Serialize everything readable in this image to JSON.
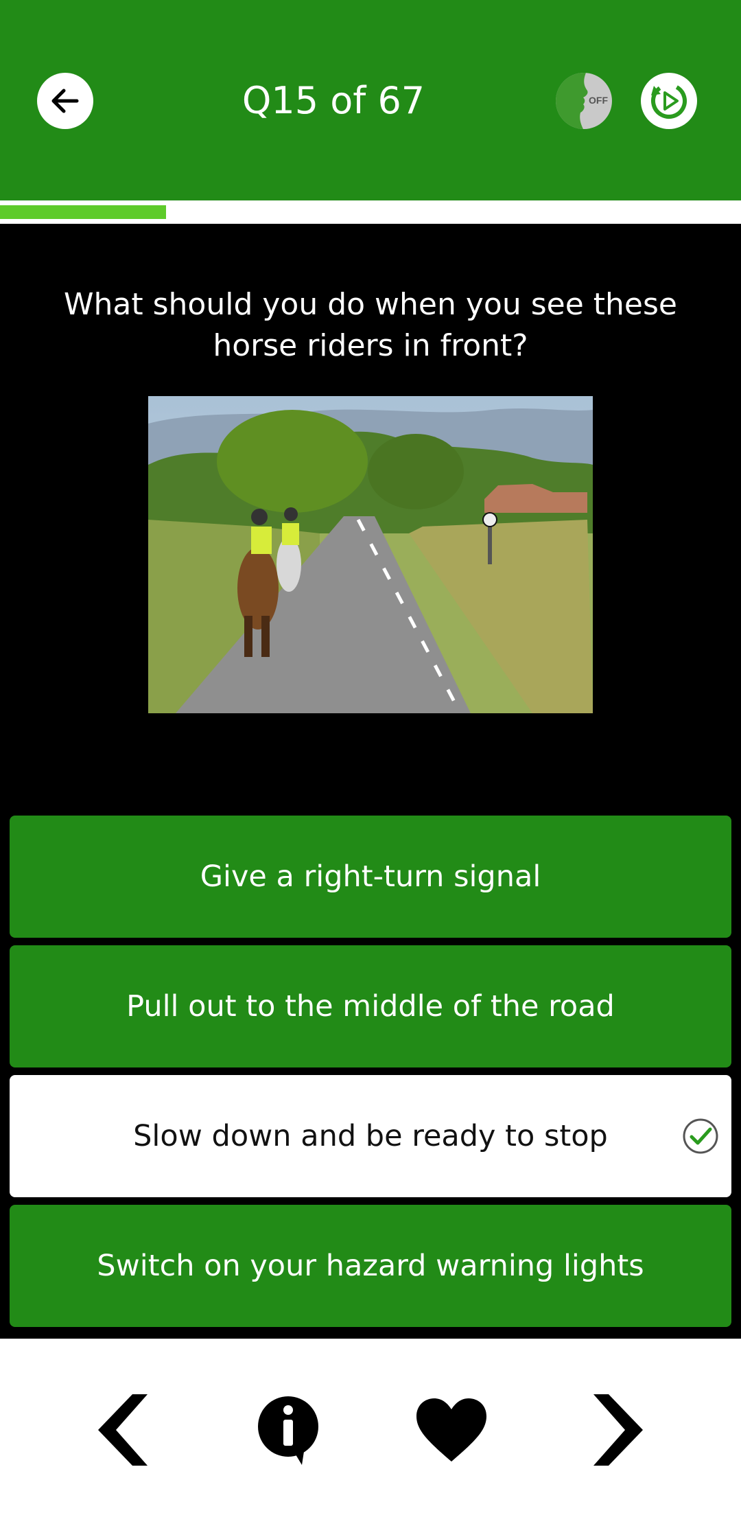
{
  "header": {
    "title": "Q15 of 67",
    "voice_toggle_label": "OFF",
    "icons": {
      "back": "arrow-left-icon",
      "voice": "voice-off-icon",
      "replay": "replay-icon"
    }
  },
  "progress": {
    "current": 15,
    "total": 67,
    "fraction": 0.224
  },
  "question": {
    "text": "What should you do when you see these horse riders in front?",
    "image": "horse-riders-country-road"
  },
  "answers": [
    {
      "label": "Give a right-turn signal",
      "selected": false
    },
    {
      "label": "Pull out to the middle of the road",
      "selected": false
    },
    {
      "label": "Slow down and be ready to stop",
      "selected": true,
      "correct": true
    },
    {
      "label": "Switch on your hazard warning lights",
      "selected": false
    }
  ],
  "bottom_nav": {
    "icons": [
      "chevron-left-icon",
      "info-icon",
      "heart-icon",
      "chevron-right-icon"
    ]
  },
  "colors": {
    "brand_green": "#228B17",
    "progress_green": "#5ECB2A",
    "background": "#000000"
  }
}
